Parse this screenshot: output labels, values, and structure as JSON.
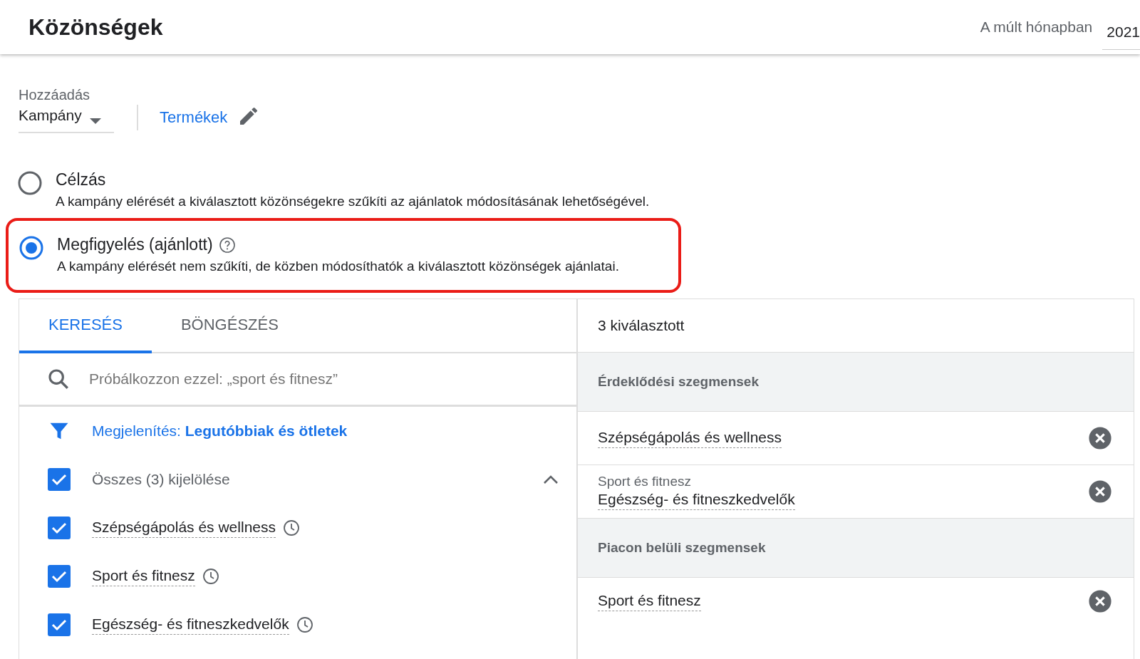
{
  "header": {
    "title": "Közönségek",
    "period_label": "A múlt hónapban",
    "period_value": "2021"
  },
  "add": {
    "label": "Hozzáadás",
    "value": "Kampány",
    "link": "Termékek"
  },
  "modes": [
    {
      "title": "Célzás",
      "description": "A kampány elérését a kiválasztott közönségekre szűkíti az ajánlatok módosításának lehetőségével.",
      "selected": false,
      "help": false,
      "highlighted": false
    },
    {
      "title": "Megfigyelés (ajánlott)",
      "description": "A kampány elérését nem szűkíti, de közben módosíthatók a kiválasztott közönségek ajánlatai.",
      "selected": true,
      "help": true,
      "highlighted": true
    }
  ],
  "tabs": [
    {
      "label": "KERESÉS",
      "selected": true
    },
    {
      "label": "BÖNGÉSZÉS",
      "selected": false
    }
  ],
  "search": {
    "placeholder": "Próbálkozzon ezzel: „sport és fitnesz”"
  },
  "filter": {
    "label": "Megjelenítés:",
    "value": "Legutóbbiak és ötletek"
  },
  "select_all": {
    "label": "Összes (3) kijelölése",
    "checked": true,
    "expanded": true
  },
  "results": [
    {
      "label": "Szépségápolás és wellness",
      "checked": true
    },
    {
      "label": "Sport és fitnesz",
      "checked": true
    },
    {
      "label": "Egészség- és fitneszkedvelők",
      "checked": true
    }
  ],
  "selected_panel": {
    "count": "3 kiválasztott",
    "rows": [
      {
        "kind": "group",
        "label": "Érdeklődési szegmensek"
      },
      {
        "kind": "item",
        "label": "Szépségápolás és wellness"
      },
      {
        "kind": "item",
        "parent": "Sport és fitnesz",
        "label": "Egészség- és fitneszkedvelők"
      },
      {
        "kind": "group",
        "label": "Piacon belüli szegmensek"
      },
      {
        "kind": "item",
        "label": "Sport és fitnesz"
      }
    ]
  }
}
